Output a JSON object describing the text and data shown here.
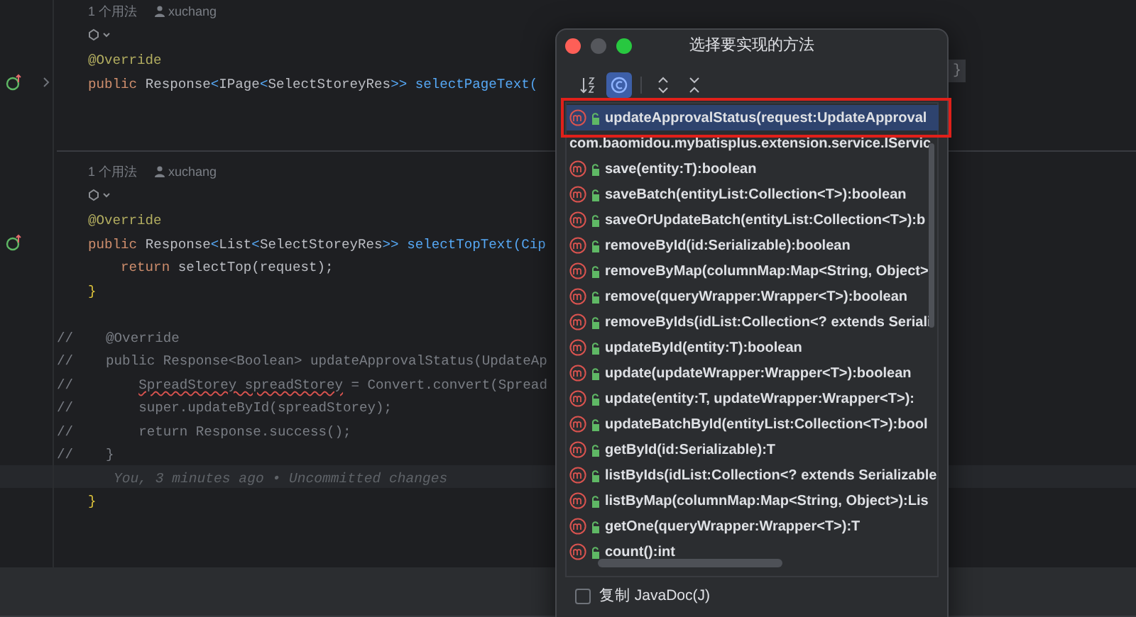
{
  "editor": {
    "lines": [
      {
        "kind": "inlay",
        "usages": "1 个用法",
        "author": "xuchang"
      },
      {
        "kind": "ai"
      },
      {
        "kind": "code",
        "tokens": [
          {
            "t": "@Override",
            "color": "#b3ae60"
          }
        ]
      },
      {
        "kind": "code",
        "override": true,
        "fold": true,
        "tokens": [
          {
            "t": "public ",
            "color": "#cf8e6d"
          },
          {
            "t": "Response",
            "color": "#bcbec4"
          },
          {
            "t": "<",
            "color": "#56a8f5"
          },
          {
            "t": "IPage",
            "color": "#bcbec4"
          },
          {
            "t": "<",
            "color": "#56a8f5"
          },
          {
            "t": "SelectStoreyRes",
            "color": "#bcbec4"
          },
          {
            "t": ">>",
            "color": "#56a8f5"
          },
          {
            "t": " selectPageText(",
            "color": "#56a8f5"
          }
        ]
      },
      {
        "kind": "blank"
      },
      {
        "kind": "blank"
      },
      {
        "kind": "separator"
      },
      {
        "kind": "inlay",
        "usages": "1 个用法",
        "author": "xuchang"
      },
      {
        "kind": "ai"
      },
      {
        "kind": "code",
        "tokens": [
          {
            "t": "@Override",
            "color": "#b3ae60"
          }
        ]
      },
      {
        "kind": "code",
        "override": true,
        "tokens": [
          {
            "t": "public ",
            "color": "#cf8e6d"
          },
          {
            "t": "Response",
            "color": "#bcbec4"
          },
          {
            "t": "<",
            "color": "#56a8f5"
          },
          {
            "t": "List",
            "color": "#bcbec4"
          },
          {
            "t": "<",
            "color": "#56a8f5"
          },
          {
            "t": "SelectStoreyRes",
            "color": "#bcbec4"
          },
          {
            "t": ">>",
            "color": "#56a8f5"
          },
          {
            "t": " selectTopText(Cip",
            "color": "#56a8f5"
          }
        ]
      },
      {
        "kind": "code",
        "tokens": [
          {
            "t": "    return ",
            "color": "#cf8e6d"
          },
          {
            "t": "selectTop(request);",
            "color": "#bcbec4"
          }
        ]
      },
      {
        "kind": "code",
        "tokens": [
          {
            "t": "}",
            "color": "#e0c53b"
          }
        ]
      },
      {
        "kind": "blank"
      },
      {
        "kind": "comment",
        "tokens": [
          {
            "t": "//    @Override",
            "color": "#7a7e85"
          }
        ]
      },
      {
        "kind": "comment",
        "tokens": [
          {
            "t": "//    public Response<Boolean> updateApprovalStatus(UpdateAp",
            "color": "#7a7e85"
          }
        ]
      },
      {
        "kind": "comment",
        "tokens": [
          {
            "t": "//        ",
            "color": "#7a7e85"
          },
          {
            "t": "SpreadStorey spreadStorey",
            "color": "#7a7e85",
            "error": true
          },
          {
            "t": " = Convert.convert(Spread",
            "color": "#7a7e85"
          }
        ]
      },
      {
        "kind": "comment",
        "tokens": [
          {
            "t": "//        super.updateById(spreadStorey);",
            "color": "#7a7e85"
          }
        ]
      },
      {
        "kind": "comment",
        "tokens": [
          {
            "t": "//        return Response.success();",
            "color": "#7a7e85"
          }
        ]
      },
      {
        "kind": "comment",
        "tokens": [
          {
            "t": "//    }",
            "color": "#7a7e85"
          }
        ]
      },
      {
        "kind": "blame",
        "text": "You, 3 minutes ago • Uncommitted changes"
      },
      {
        "kind": "code",
        "tokens": [
          {
            "t": "}",
            "color": "#e0c53b"
          }
        ]
      }
    ],
    "hint": "}"
  },
  "dialog": {
    "title": "选择要实现的方法",
    "toolbar": [
      {
        "kind": "sort",
        "selected": false
      },
      {
        "kind": "class",
        "selected": true
      },
      {
        "kind": "expand",
        "selected": false
      },
      {
        "kind": "collapse",
        "selected": false
      }
    ],
    "items": [
      {
        "kind": "method",
        "text": "updateApprovalStatus(request:UpdateApproval",
        "selected": true,
        "highlighted": true
      },
      {
        "kind": "group",
        "text": "com.baomidou.mybatisplus.extension.service.IServic",
        "selected": false
      },
      {
        "kind": "method",
        "text": "save(entity:T):boolean",
        "selected": false
      },
      {
        "kind": "method",
        "text": "saveBatch(entityList:Collection<T>):boolean",
        "selected": false
      },
      {
        "kind": "method",
        "text": "saveOrUpdateBatch(entityList:Collection<T>):b",
        "selected": false
      },
      {
        "kind": "method",
        "text": "removeById(id:Serializable):boolean",
        "selected": false
      },
      {
        "kind": "method",
        "text": "removeByMap(columnMap:Map<String, Object>",
        "selected": false
      },
      {
        "kind": "method",
        "text": "remove(queryWrapper:Wrapper<T>):boolean",
        "selected": false
      },
      {
        "kind": "method",
        "text": "removeByIds(idList:Collection<? extends Seriali",
        "selected": false
      },
      {
        "kind": "method",
        "text": "updateById(entity:T):boolean",
        "selected": false
      },
      {
        "kind": "method",
        "text": "update(updateWrapper:Wrapper<T>):boolean",
        "selected": false
      },
      {
        "kind": "method",
        "text": "update(entity:T, updateWrapper:Wrapper<T>):",
        "selected": false
      },
      {
        "kind": "method",
        "text": "updateBatchById(entityList:Collection<T>):bool",
        "selected": false
      },
      {
        "kind": "method",
        "text": "getById(id:Serializable):T",
        "selected": false
      },
      {
        "kind": "method",
        "text": "listByIds(idList:Collection<? extends Serializable",
        "selected": false
      },
      {
        "kind": "method",
        "text": "listByMap(columnMap:Map<String, Object>):Lis",
        "selected": false
      },
      {
        "kind": "method",
        "text": "getOne(queryWrapper:Wrapper<T>):T",
        "selected": false
      },
      {
        "kind": "method",
        "text": "count():int",
        "selected": false
      }
    ],
    "copy_javadoc": {
      "label": "复制 JavaDoc(J)",
      "checked": false
    }
  }
}
